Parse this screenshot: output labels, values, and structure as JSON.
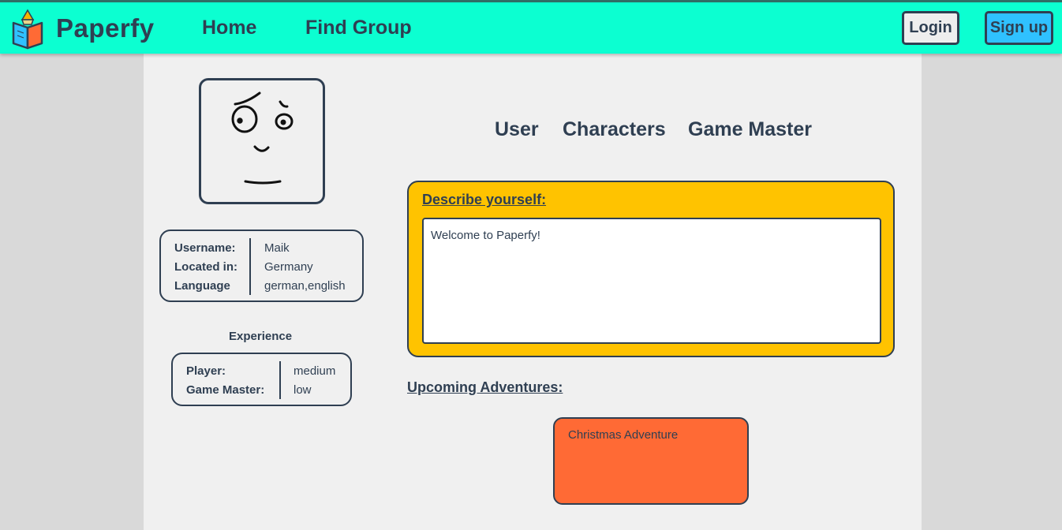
{
  "header": {
    "brand": "Paperfy",
    "logo_icon": "book-pencil-icon",
    "nav": [
      "Home",
      "Find Group"
    ],
    "login_label": "Login",
    "signup_label": "Sign up"
  },
  "profile": {
    "avatar_icon": "doodle-face-icon",
    "info": {
      "labels": [
        "Username:",
        "Located in:",
        "Language"
      ],
      "values": [
        "Maik",
        "Germany",
        "german,english"
      ]
    },
    "experience": {
      "title": "Experience",
      "labels": [
        "Player:",
        "Game Master:"
      ],
      "values": [
        "medium",
        "low"
      ]
    }
  },
  "tabs": [
    "User",
    "Characters",
    "Game Master"
  ],
  "description": {
    "title": "Describe yourself:",
    "text": "Welcome to Paperfy!"
  },
  "upcoming": {
    "title": "Upcoming Adventures:",
    "adventures": [
      "Christmas Adventure"
    ]
  },
  "colors": {
    "header_bg": "#0cffd1",
    "text": "#2f3f52",
    "describe_bg": "#ffc300",
    "adventure_bg": "#ff6a35",
    "signup_bg": "#2fc1ff"
  }
}
